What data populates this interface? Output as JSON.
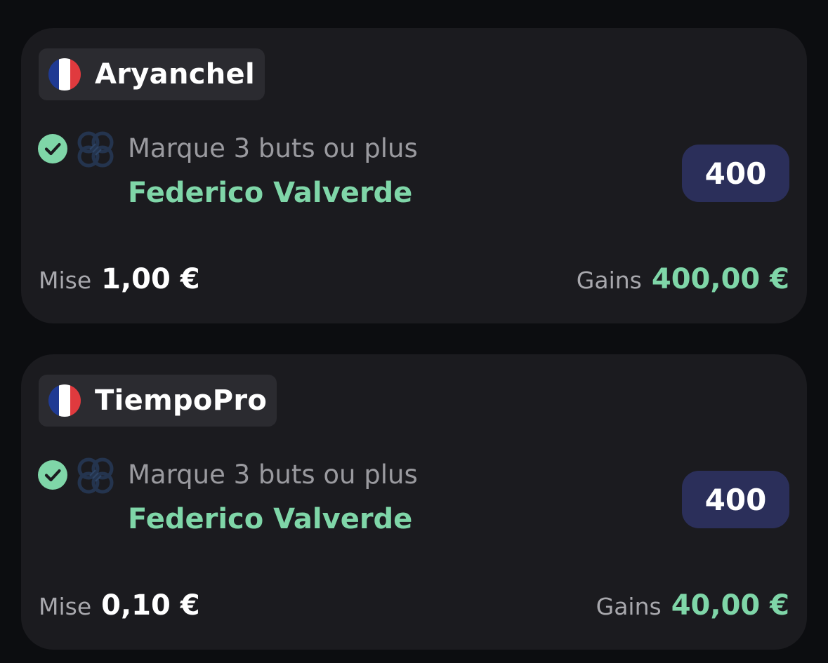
{
  "bets": [
    {
      "username": "Aryanchel",
      "flag": {
        "name": "france-flag",
        "colors": [
          "#1f3a93",
          "#ffffff",
          "#e03a3e"
        ]
      },
      "status_icon": "check-circle-icon",
      "team_icon": "team-crest-icon",
      "market": "Marque 3 buts ou plus",
      "player": "Federico Valverde",
      "odds": "400",
      "stake_label": "Mise",
      "stake": "1,00 €",
      "winnings_label": "Gains",
      "winnings": "400,00 €"
    },
    {
      "username": "TiempoPro",
      "flag": {
        "name": "france-flag",
        "colors": [
          "#1f3a93",
          "#ffffff",
          "#e03a3e"
        ]
      },
      "status_icon": "check-circle-icon",
      "team_icon": "team-crest-icon",
      "market": "Marque 3 buts ou plus",
      "player": "Federico Valverde",
      "odds": "400",
      "stake_label": "Mise",
      "stake": "0,10 €",
      "winnings_label": "Gains",
      "winnings": "40,00 €"
    }
  ],
  "colors": {
    "background": "#0c0d10",
    "card": "#1b1b1f",
    "chip": "#2b2b30",
    "accent_green": "#7fd6a8",
    "odds_badge": "#2b2f5a",
    "muted_text": "#9a9a9f"
  }
}
